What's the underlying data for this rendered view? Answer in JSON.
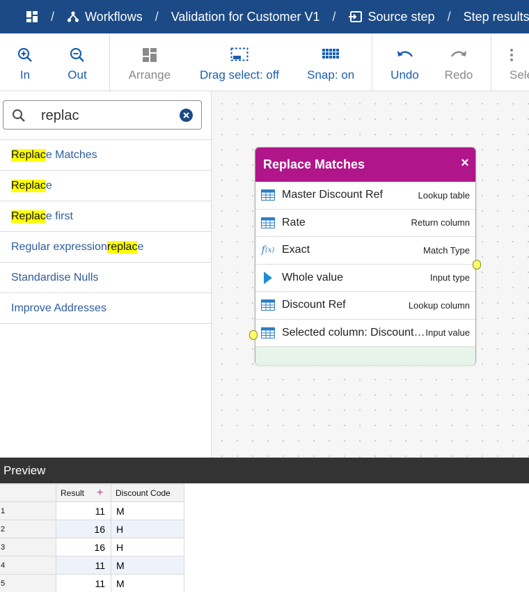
{
  "breadcrumb": {
    "items": [
      {
        "label": "Workflows",
        "icon": "workflow-icon"
      },
      {
        "label": "Validation for Customer V1"
      },
      {
        "label": "Source step",
        "icon": "source-step-icon"
      },
      {
        "label": "Step results"
      }
    ]
  },
  "toolbar": {
    "zoom_in": "In",
    "zoom_out": "Out",
    "arrange": "Arrange",
    "drag_select": "Drag select: off",
    "snap": "Snap: on",
    "undo": "Undo",
    "redo": "Redo",
    "select_partial": "Sele"
  },
  "search": {
    "value": "replac"
  },
  "results": [
    {
      "highlight": "Replac",
      "pre": "",
      "post": "e Matches"
    },
    {
      "highlight": "Replac",
      "pre": "",
      "post": "e"
    },
    {
      "highlight": "Replac",
      "pre": "",
      "post": "e first"
    },
    {
      "highlight": "replac",
      "pre": "Regular expression ",
      "post": "e"
    },
    {
      "highlight": "",
      "pre": "Standardise Nulls",
      "post": ""
    },
    {
      "highlight": "",
      "pre": "Improve Addresses",
      "post": ""
    }
  ],
  "node": {
    "title": "Replace Matches",
    "rows": [
      {
        "icon": "table-icon",
        "label": "Master Discount Ref",
        "type": "Lookup table"
      },
      {
        "icon": "table-icon",
        "label": "Rate",
        "type": "Return column"
      },
      {
        "icon": "function-icon",
        "label": "Exact",
        "type": "Match Type"
      },
      {
        "icon": "play-icon",
        "label": "Whole value",
        "type": "Input type"
      },
      {
        "icon": "table-icon",
        "label": "Discount Ref",
        "type": "Lookup column"
      },
      {
        "icon": "table-icon",
        "label": "Selected column: Discount Code",
        "type": "Input value"
      }
    ]
  },
  "preview": {
    "title": "Preview",
    "columns": [
      "Result",
      "Discount Code"
    ],
    "rows": [
      {
        "index": "1",
        "result": "11",
        "code": "M"
      },
      {
        "index": "2",
        "result": "16",
        "code": "H"
      },
      {
        "index": "3",
        "result": "16",
        "code": "H"
      },
      {
        "index": "4",
        "result": "11",
        "code": "M"
      },
      {
        "index": "5",
        "result": "11",
        "code": "M"
      }
    ]
  },
  "colors": {
    "header_bg": "#1b4a86",
    "accent_blue": "#1b5fb0",
    "node_header": "#b0158a",
    "highlight": "#ffff00",
    "preview_bar": "#333333"
  }
}
